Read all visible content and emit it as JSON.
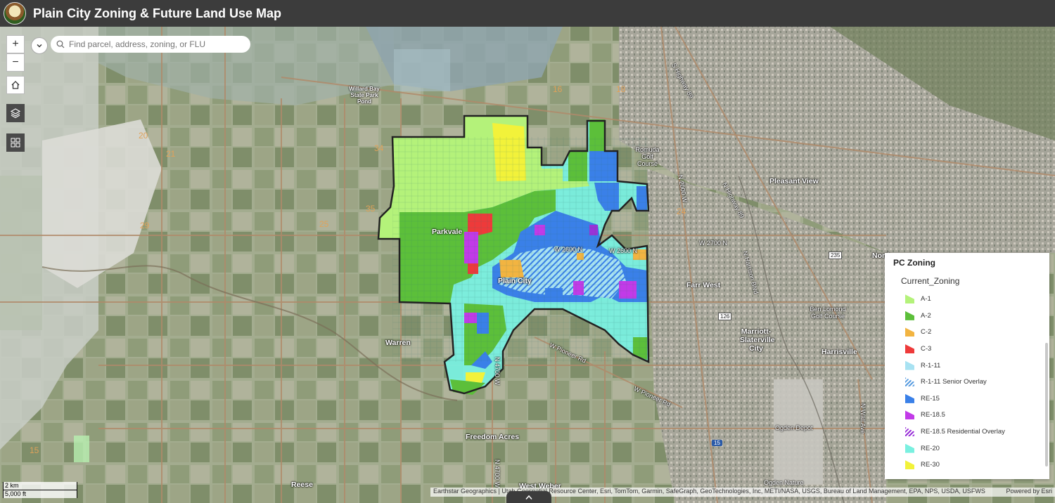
{
  "app": {
    "title": "Plain City Zoning & Future Land Use Map"
  },
  "search": {
    "placeholder": "Find parcel, address, zoning, or FLU"
  },
  "controls": {
    "zoom_in": "+",
    "zoom_out": "−"
  },
  "legend": {
    "title": "PC Zoning",
    "field": "Current_Zoning",
    "items": [
      {
        "label": "A-1",
        "color": "#b4f27a"
      },
      {
        "label": "A-2",
        "color": "#5cbf3a"
      },
      {
        "label": "C-2",
        "color": "#f2b441"
      },
      {
        "label": "C-3",
        "color": "#ee3a3a"
      },
      {
        "label": "R-1-11",
        "color": "#a8e2f2"
      },
      {
        "label": "R-1-11 Senior Overlay",
        "color": "#5a9de0"
      },
      {
        "label": "RE-15",
        "color": "#3a80e8"
      },
      {
        "label": "RE-18.5",
        "color": "#c23ae8"
      },
      {
        "label": "RE-18.5 Residential Overlay",
        "color": "#9a32d8"
      },
      {
        "label": "RE-20",
        "color": "#7af0e0"
      },
      {
        "label": "RE-30",
        "color": "#f2f23a"
      }
    ]
  },
  "scalebar": {
    "km": "2 km",
    "ft": "5,000 ft"
  },
  "attribution": {
    "text": "Earthstar Geographics | Utah Geospatial Resource Center, Esri, TomTom, Garmin, SafeGraph, GeoTechnologies, Inc, METI/NASA, USGS, Bureau of Land Management, EPA, NPS, USDA, USFWS",
    "powered": "Powered by Esri"
  },
  "places": {
    "willard_bay": "Willard Bay State Park Pond",
    "romuda": "Romuda Golf Course",
    "pleasant_view": "Pleasant View",
    "parkvale": "Parkvale",
    "plain_city": "Plain City",
    "farr_west": "Farr West",
    "ben_lomond": "Ben Lomond Golf Course",
    "marriott": "Marriott-Slaterville City",
    "harrisville": "Harrisville",
    "warren": "Warren",
    "freedom_acres": "Freedom Acres",
    "reese": "Reese",
    "west_weber": "West Weber",
    "ogden_depot": "Ogden Depot",
    "ogden_nature": "Ogden Nature",
    "north_ogden_partial": "North"
  },
  "roads": {
    "w2600n_a": "W 2600 N",
    "w2600n_b": "W 2600 N",
    "w2700n": "W 2700 N",
    "n2000w": "N 2000 W",
    "n_hwy89": "N Highway 89",
    "s_hwy89": "S Highway 89",
    "w_pioneer_a": "W Pioneer Rd",
    "w_pioneer_b": "W Pioneer Rd",
    "n4700w_a": "N 4700 W",
    "n4700w_b": "N 4700 W",
    "n_wall": "N Wall Ave",
    "n_harrison": "N Harrison Blvd",
    "shield_126": "126",
    "shield_235": "235",
    "shield_i15": "15"
  },
  "sections": [
    "20",
    "21",
    "29",
    "25",
    "34",
    "35",
    "24",
    "16",
    "18",
    "15"
  ]
}
